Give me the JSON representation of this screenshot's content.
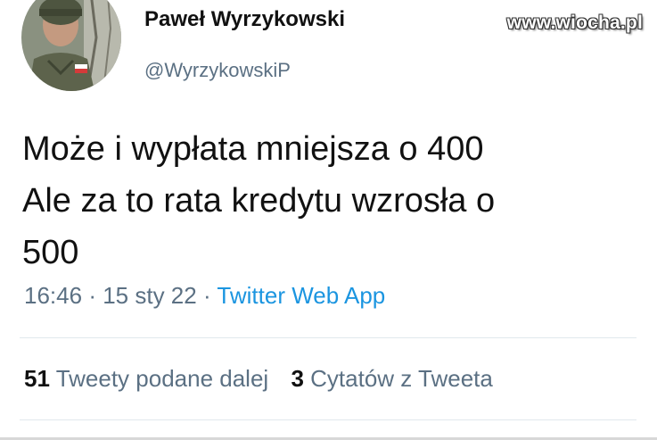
{
  "author": {
    "display_name": "Paweł Wyrzykowski",
    "handle": "@WyrzykowskiP"
  },
  "watermark": "www.wiocha.pl",
  "tweet": {
    "lines": [
      "Może i wypłata mniejsza o 400",
      "Ale za to rata kredytu wzrosła o",
      "500"
    ],
    "time": "16:46",
    "date": "15 sty 22",
    "separator": "·",
    "source": "Twitter Web App"
  },
  "stats": {
    "retweets_count": "51",
    "retweets_label": "Tweety podane dalej",
    "quotes_count": "3",
    "quotes_label": "Cytatów z Tweeta"
  },
  "colors": {
    "text": "#111111",
    "secondary": "#5b7083",
    "link": "#1b95e0",
    "divider": "#e1e8ed"
  },
  "icons": {
    "avatar": "profile-photo-avatar"
  }
}
